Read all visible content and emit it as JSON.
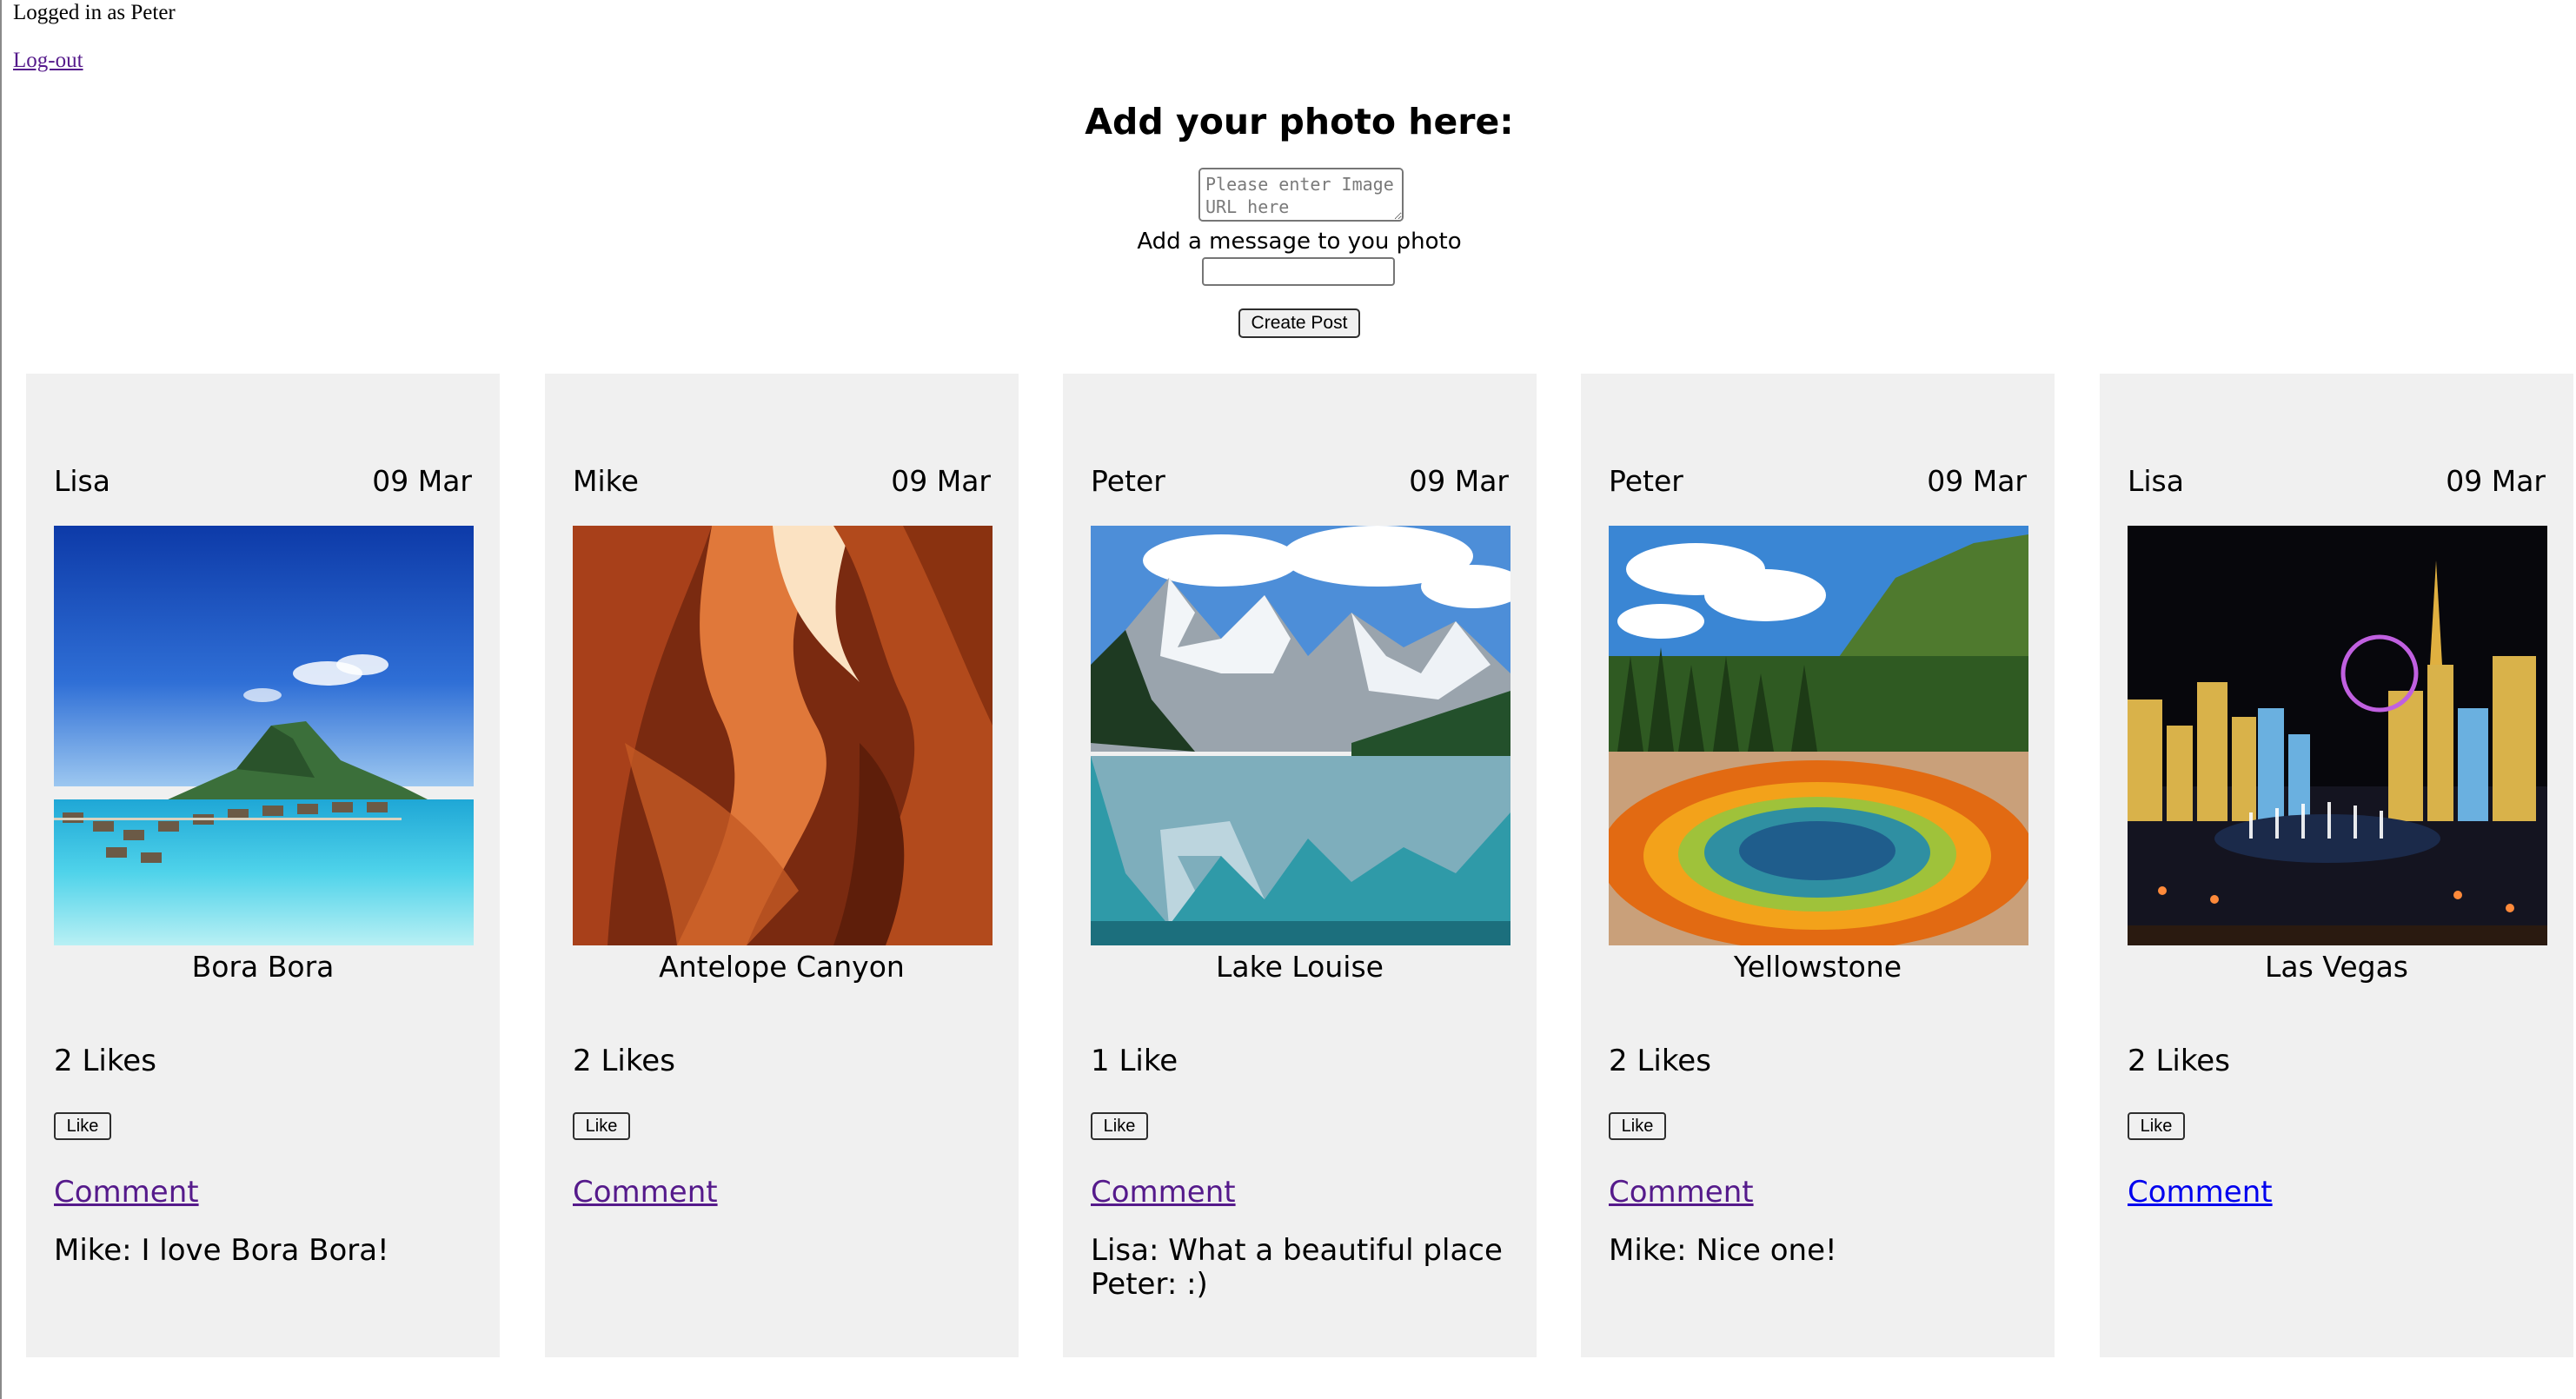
{
  "session": {
    "status": "Logged in as Peter",
    "logout_label": "Log-out"
  },
  "form": {
    "title": "Add your photo here:",
    "url_placeholder": "Please enter Image URL here",
    "message_label": "Add a message to you photo",
    "message_value": "",
    "submit_label": "Create Post"
  },
  "posts": [
    {
      "author": "Lisa",
      "date": "09 Mar",
      "caption": "Bora Bora",
      "likes": "2 Likes",
      "like_label": "Like",
      "comment_label": "Comment",
      "comments": [
        "Mike: I love Bora Bora!"
      ]
    },
    {
      "author": "Mike",
      "date": "09 Mar",
      "caption": "Antelope Canyon",
      "likes": "2 Likes",
      "like_label": "Like",
      "comment_label": "Comment",
      "comments": []
    },
    {
      "author": "Peter",
      "date": "09 Mar",
      "caption": "Lake Louise",
      "likes": "1 Like",
      "like_label": "Like",
      "comment_label": "Comment",
      "comments": [
        "Lisa: What a beautiful place",
        "Peter: :)"
      ]
    },
    {
      "author": "Peter",
      "date": "09 Mar",
      "caption": "Yellowstone",
      "likes": "2 Likes",
      "like_label": "Like",
      "comment_label": "Comment",
      "comments": [
        "Mike: Nice one!"
      ]
    },
    {
      "author": "Lisa",
      "date": "09 Mar",
      "caption": "Las Vegas",
      "likes": "2 Likes",
      "like_label": "Like",
      "comment_label": "Comment",
      "comments": []
    }
  ],
  "colors": {
    "card_bg": "#f0f0f0",
    "visited_link": "#551a8b",
    "link": "#0000ee"
  }
}
